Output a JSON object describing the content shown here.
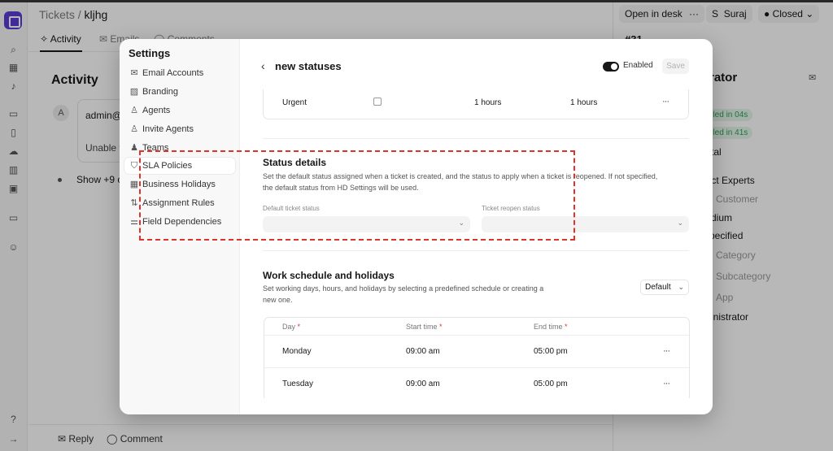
{
  "breadcrumb": {
    "parent": "Tickets",
    "separator": " / ",
    "current": "kljhg"
  },
  "tabs": [
    {
      "label": "Activity"
    },
    {
      "label": "Emails"
    },
    {
      "label": "Comments"
    }
  ],
  "activity": {
    "title": "Activity",
    "avatar_initial": "A",
    "entry_author": "admin@e",
    "entry_text": "Unable to",
    "show_more": "Show +9 c"
  },
  "bottom_bar": {
    "reply_label": "Reply",
    "comment_label": "Comment"
  },
  "header_actions": {
    "open_in_desk": "Open in desk",
    "more": "···",
    "user_initial": "S",
    "user_name": "Suraj",
    "status": "Closed"
  },
  "right_panel": {
    "ticket_number": "#31",
    "assignee_title": "rator",
    "sla_first": "illed in 04s",
    "sla_resolution": "illed in 41s",
    "type_value": "tal",
    "team_value": "duct Experts",
    "customer_placeholder": "Customer",
    "priority_value": "dium",
    "status_value": "pecified",
    "category_placeholder": "Category",
    "subcategory_placeholder": "Subcategory",
    "app_placeholder": "App",
    "contact_value": "ministrator"
  },
  "settings": {
    "title": "Settings",
    "nav": [
      {
        "label": "Email Accounts",
        "icon": "mail-icon"
      },
      {
        "label": "Branding",
        "icon": "image-icon"
      },
      {
        "label": "Agents",
        "icon": "user-icon"
      },
      {
        "label": "Invite Agents",
        "icon": "user-plus-icon"
      },
      {
        "label": "Teams",
        "icon": "users-icon"
      },
      {
        "label": "SLA Policies",
        "icon": "shield-icon",
        "active": true
      },
      {
        "label": "Business Holidays",
        "icon": "calendar-icon"
      },
      {
        "label": "Assignment Rules",
        "icon": "route-icon"
      },
      {
        "label": "Field Dependencies",
        "icon": "sliders-icon"
      }
    ]
  },
  "sla_page": {
    "title": "new statuses",
    "enabled_label": "Enabled",
    "enabled": true,
    "save_label": "Save",
    "priority_row": {
      "priority": "Urgent",
      "first_response": "1 hours",
      "resolution": "1 hours",
      "menu": "···"
    }
  },
  "status_details": {
    "title": "Status details",
    "description": "Set the default status assigned when a ticket is created, and the status to apply when a ticket is reopened. If not specified, the default status from HD Settings will be used.",
    "default_status_label": "Default ticket status",
    "default_status_value": "",
    "reopen_status_label": "Ticket reopen status",
    "reopen_status_value": ""
  },
  "work_schedule": {
    "title": "Work schedule and holidays",
    "description": "Set working days, hours, and holidays by selecting a predefined schedule or creating a new one.",
    "schedule_select": "Default",
    "columns": [
      "Day",
      "Start time",
      "End time"
    ],
    "required_marker": "*",
    "rows": [
      {
        "day": "Monday",
        "start": "09:00 am",
        "end": "05:00 pm",
        "menu": "···"
      },
      {
        "day": "Tuesday",
        "start": "09:00 am",
        "end": "05:00 pm",
        "menu": "···"
      }
    ]
  },
  "colors": {
    "accent": "#5b3bd6",
    "highlight_border": "#e0322b",
    "toggle_on": "#171717"
  }
}
